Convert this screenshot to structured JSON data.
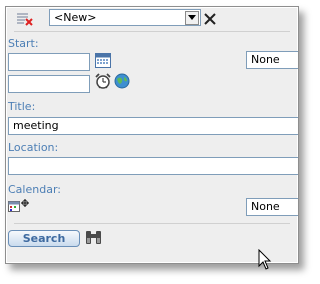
{
  "toolbar": {
    "list_icon": "list-delete-icon",
    "template_select": "<New>",
    "close_icon": "close-x-icon"
  },
  "start": {
    "label": "Start:",
    "date_value": "",
    "time_value": "",
    "timezone": "None"
  },
  "title": {
    "label": "Title:",
    "value": "meeting"
  },
  "location": {
    "label": "Location:",
    "value": ""
  },
  "calendar": {
    "label": "Calendar:",
    "picker_value": "None"
  },
  "actions": {
    "search_label": "Search"
  },
  "colors": {
    "label_blue": "#4d7fb5",
    "panel_bg": "#eeeeee",
    "field_border": "#7f9db9"
  }
}
